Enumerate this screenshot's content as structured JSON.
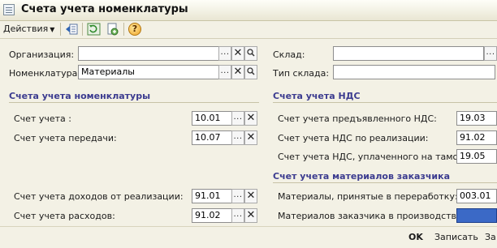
{
  "window": {
    "title": "Счета учета номенклатуры"
  },
  "toolbar": {
    "actions_label": "Действия",
    "help_label": "?"
  },
  "form": {
    "organization_label": "Организация:",
    "organization_value": "",
    "nomenclature_label": "Номенклатура:",
    "nomenclature_value": "Материалы",
    "warehouse_label": "Склад:",
    "warehouse_value": "",
    "warehouse_type_label": "Тип склада:",
    "warehouse_type_value": ""
  },
  "nomenclature_accounts": {
    "header": "Счета учета номенклатуры",
    "rows": [
      {
        "label": "Счет учета :",
        "value": "10.01"
      },
      {
        "label": "Счет учета передачи:",
        "value": "10.07"
      },
      {
        "label": "Счет учета доходов от реализации:",
        "value": "91.01"
      },
      {
        "label": "Счет учета расходов:",
        "value": "91.02"
      }
    ]
  },
  "vat_accounts": {
    "header": "Счета учета НДС",
    "rows": [
      {
        "label": "Счет учета предъявленного НДС:",
        "value": "19.03"
      },
      {
        "label": "Счет учета НДС по реализации:",
        "value": "91.02"
      },
      {
        "label": "Счет учета НДС, уплаченного на таможне:",
        "value": "19.05"
      }
    ]
  },
  "customer_materials": {
    "header": "Счет учета материалов заказчика",
    "rows": [
      {
        "label": "Материалы, принятые в переработку:",
        "value": "003.01"
      },
      {
        "label": "Материалов заказчика в производстве:",
        "value": ""
      }
    ]
  },
  "footer": {
    "ok_label": "OK",
    "save_label": "Записать",
    "close_label": "За"
  },
  "colors": {
    "highlight_field": "#3b69c6",
    "section_header": "#3b3b8f",
    "window_bg": "#f3f1e5"
  }
}
